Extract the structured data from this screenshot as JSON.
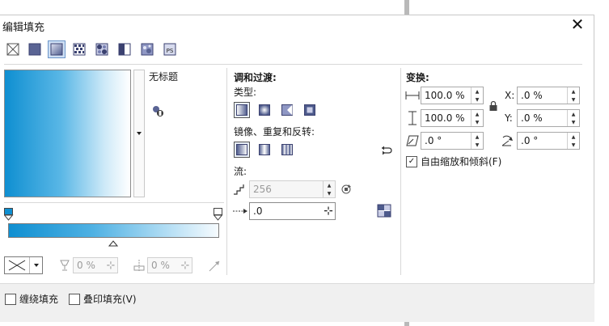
{
  "window": {
    "title": "编辑填充",
    "close_glyph": "✕"
  },
  "fill_types": [
    {
      "id": "none",
      "icon": "no-fill-icon"
    },
    {
      "id": "uniform",
      "icon": "uniform-fill-icon"
    },
    {
      "id": "fountain",
      "icon": "fountain-fill-icon",
      "selected": true
    },
    {
      "id": "vector-pattern",
      "icon": "vector-pattern-icon"
    },
    {
      "id": "bitmap-pattern",
      "icon": "bitmap-pattern-icon"
    },
    {
      "id": "two-color",
      "icon": "two-color-pattern-icon"
    },
    {
      "id": "texture",
      "icon": "texture-fill-icon"
    },
    {
      "id": "postscript",
      "icon": "postscript-fill-icon",
      "text": "PS"
    }
  ],
  "preview": {
    "name": "无标题"
  },
  "blend": {
    "heading": "调和过渡:",
    "type_label": "类型:",
    "mirror_label": "镜像、重复和反转:",
    "flow_label": "流:",
    "steps_value": "256",
    "accel_value": ".0"
  },
  "transform": {
    "heading": "变换:",
    "width_value": "100.0 %",
    "height_value": "100.0 %",
    "x_label": "X:",
    "x_value": ".0 %",
    "y_label": "Y:",
    "y_value": ".0 %",
    "skew_value": ".0 °",
    "rotate_value": ".0 °",
    "free_scale_label": "自由缩放和倾斜(F)",
    "free_scale_checked": true
  },
  "gradient_controls": {
    "node_position_value": "0 %",
    "midpoint_value": "0 %"
  },
  "bottom": {
    "wrap_fill_label": "缠绕填充",
    "overprint_label": "叠印填充(V)"
  },
  "colors": {
    "gradient_start": "#0f8fd1",
    "gradient_end": "#ffffff",
    "selection": "#cfe0f5"
  }
}
